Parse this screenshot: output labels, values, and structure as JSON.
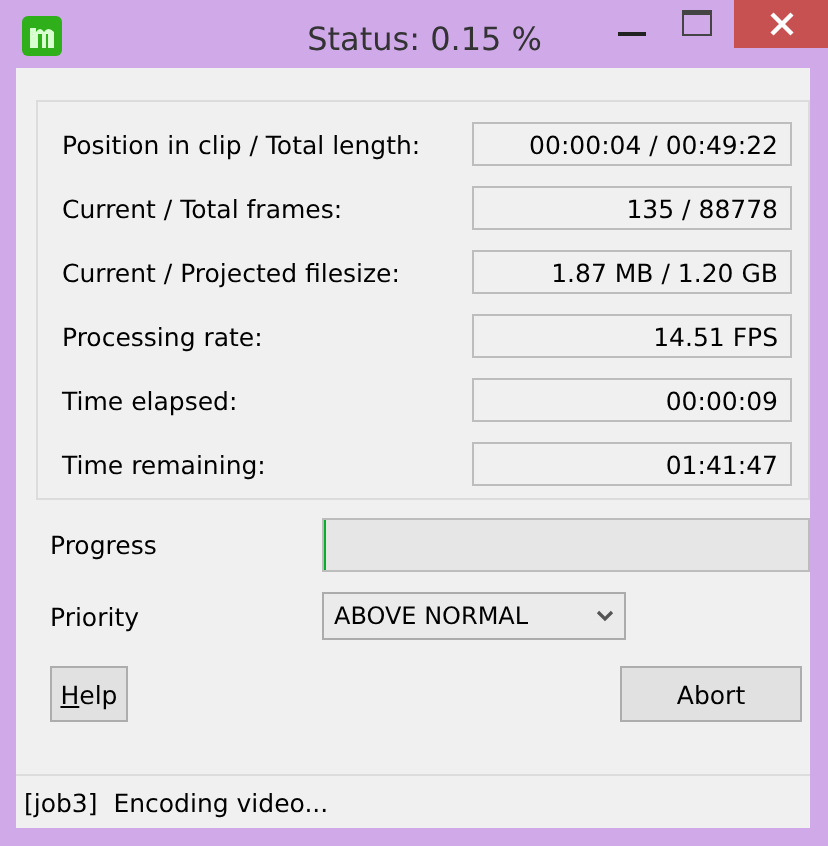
{
  "window": {
    "title": "Status: 0.15 %"
  },
  "stats": [
    {
      "label": "Position in clip / Total length:",
      "value": "00:00:04 / 00:49:22"
    },
    {
      "label": "Current / Total frames:",
      "value": "135 / 88778"
    },
    {
      "label": "Current / Projected filesize:",
      "value": "1.87 MB / 1.20 GB"
    },
    {
      "label": "Processing rate:",
      "value": "14.51 FPS"
    },
    {
      "label": "Time elapsed:",
      "value": "00:00:09"
    },
    {
      "label": "Time remaining:",
      "value": "01:41:47"
    }
  ],
  "progress": {
    "label": "Progress",
    "level": 0.0015
  },
  "priority": {
    "label": "Priority",
    "value": "ABOVE NORMAL"
  },
  "buttons": {
    "help": "Help",
    "abort": "Abort"
  },
  "status_bar": "[job3]  Encoding video..."
}
